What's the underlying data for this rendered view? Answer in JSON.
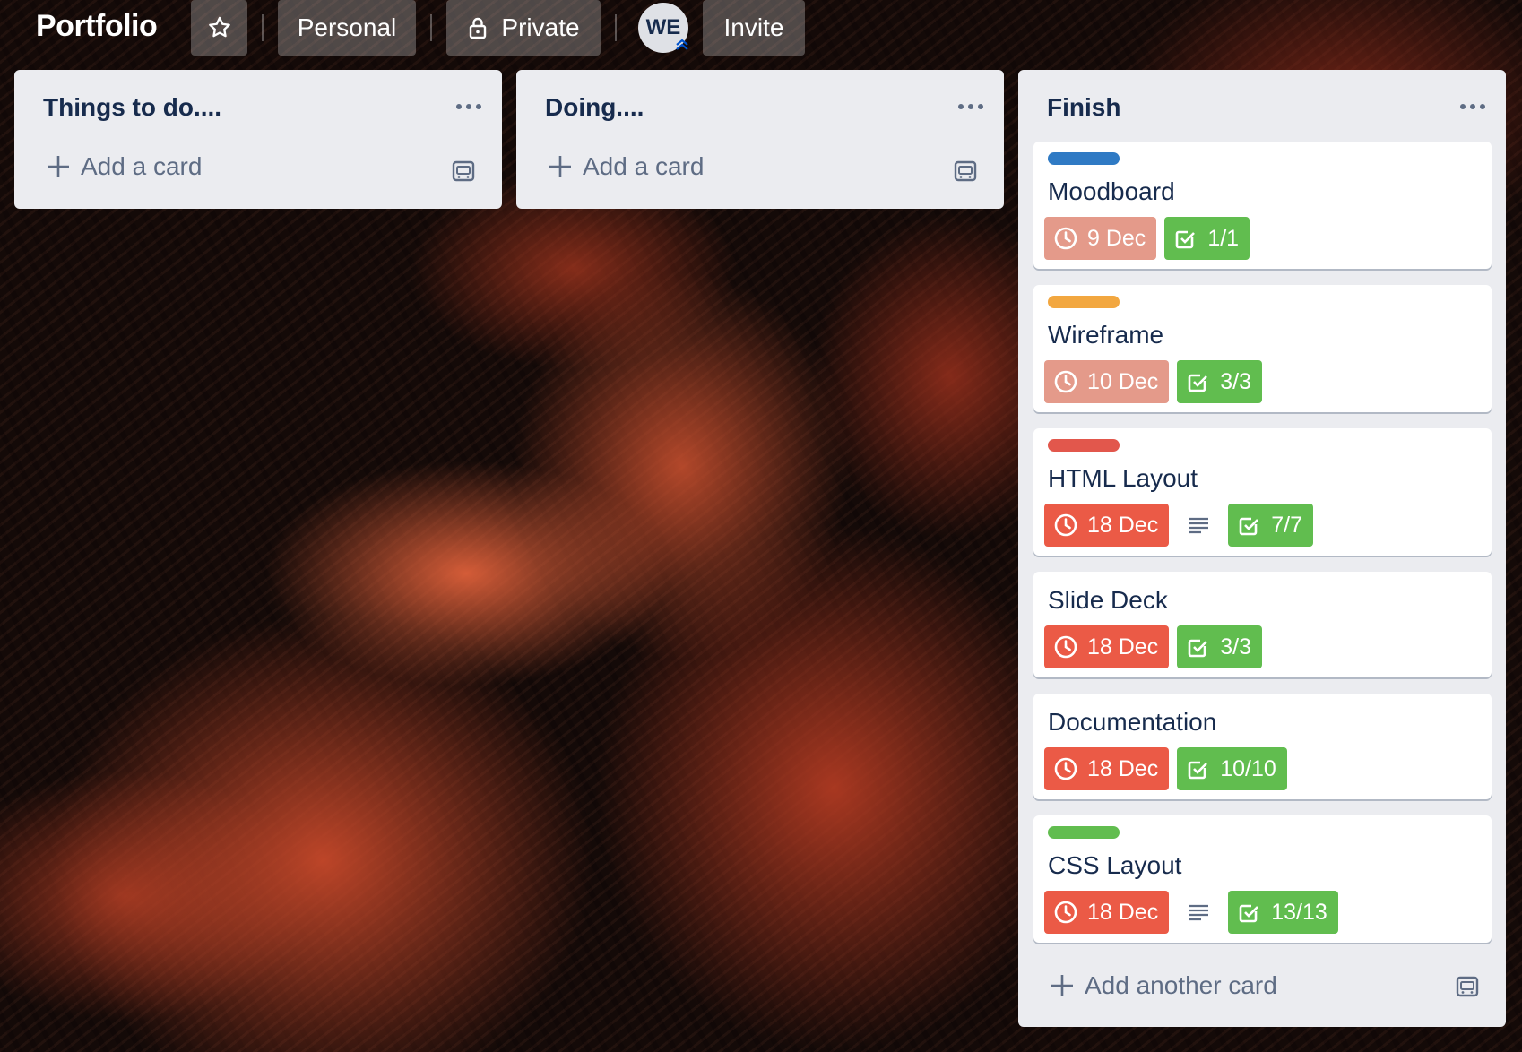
{
  "header": {
    "board_title": "Portfolio",
    "personal_label": "Personal",
    "private_label": "Private",
    "avatar_initials": "WE",
    "invite_label": "Invite"
  },
  "lists": [
    {
      "title": "Things to do....",
      "add_card_label": "Add a card"
    },
    {
      "title": "Doing....",
      "add_card_label": "Add a card"
    },
    {
      "title": "Finish",
      "add_card_label": "Add another card",
      "cards": [
        {
          "title": "Moodboard",
          "label_color": "#2f7ac4",
          "due": "9 Dec",
          "due_color": "#e49a8a",
          "checklist": "1/1",
          "has_description": false
        },
        {
          "title": "Wireframe",
          "label_color": "#f2a740",
          "due": "10 Dec",
          "due_color": "#e49a8a",
          "checklist": "3/3",
          "has_description": false
        },
        {
          "title": "HTML Layout",
          "label_color": "#e2574c",
          "due": "18 Dec",
          "due_color": "#eb5a46",
          "checklist": "7/7",
          "has_description": true
        },
        {
          "title": "Slide Deck",
          "label_color": null,
          "due": "18 Dec",
          "due_color": "#eb5a46",
          "checklist": "3/3",
          "has_description": false
        },
        {
          "title": "Documentation",
          "label_color": null,
          "due": "18 Dec",
          "due_color": "#eb5a46",
          "checklist": "10/10",
          "has_description": false
        },
        {
          "title": "CSS Layout",
          "label_color": "#61bd4f",
          "due": "18 Dec",
          "due_color": "#eb5a46",
          "checklist": "13/13",
          "has_description": true
        }
      ]
    }
  ],
  "icons": {
    "star": "star-icon",
    "lock": "lock-icon",
    "list_menu": "ellipsis-icon",
    "add": "plus-icon",
    "template": "card-template-icon",
    "due": "clock-icon",
    "checklist": "checkbox-icon",
    "description": "description-lines-icon"
  },
  "colors": {
    "list_bg": "#ebecf0",
    "header_button_bg": "rgba(255,255,255,0.26)",
    "check_badge": "#61bd4f",
    "title_text": "#172b4d"
  }
}
